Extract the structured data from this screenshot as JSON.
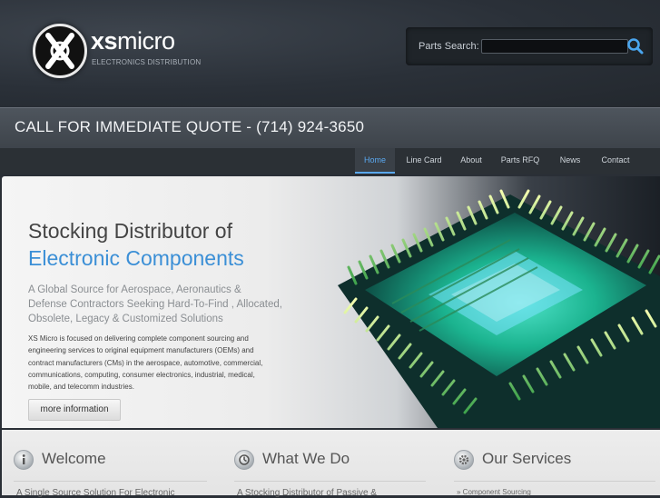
{
  "header": {
    "brand_bold": "xs",
    "brand_rest": "micro",
    "tagline": "ELECTRONICS DISTRIBUTION",
    "search_label": "Parts Search:",
    "search_placeholder": ""
  },
  "quote_bar": {
    "text": "CALL FOR IMMEDIATE QUOTE - (714) 924-3650"
  },
  "nav": {
    "items": [
      {
        "label": "Home",
        "active": true
      },
      {
        "label": "Line Card"
      },
      {
        "label": "About"
      },
      {
        "label": "Parts RFQ"
      },
      {
        "label": "News"
      },
      {
        "label": "Contact"
      }
    ]
  },
  "hero": {
    "title_line1": "Stocking Distributor of",
    "title_line2": "Electronic Components",
    "subtitle": "A Global Source for Aerospace, Aeronautics & Defense Contractors Seeking Hard-To-Find , Allocated, Obsolete, Legacy & Customized Solutions",
    "body": "XS Micro is focused on delivering complete component sourcing and engineering services to original equipment manufacturers (OEMs) and contract manufacturers (CMs) in the aerospace, automotive, commercial, communications, computing, consumer electronics, industrial, medical, mobile, and telecomm industries.",
    "button_label": "more information"
  },
  "columns": [
    {
      "title": "Welcome",
      "text": "A Single Source Solution For Electronic"
    },
    {
      "title": "What We Do",
      "text": "A Stocking Distributor of Passive &"
    },
    {
      "title": "Our Services",
      "text": "» Component Sourcing"
    }
  ],
  "colors": {
    "accent": "#3b8fd6",
    "nav_active": "#5aa8f0",
    "header_bg": "#2a3038"
  }
}
